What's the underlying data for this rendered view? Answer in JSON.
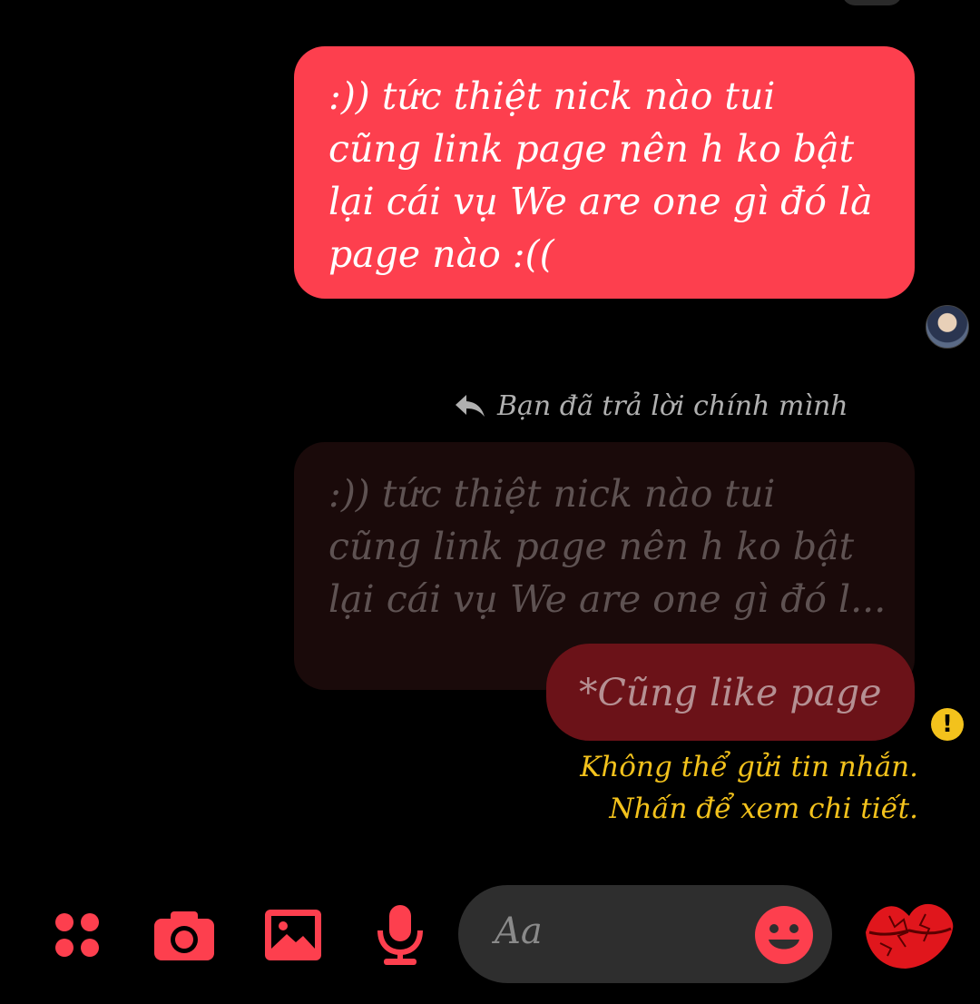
{
  "colors": {
    "accent": "#fd3f4e",
    "warning": "#f3c21c",
    "background": "#000000"
  },
  "messages": {
    "sent": {
      "lines": [
        ":)) tức thiệt nick nào tui",
        "cũng link page nên h ko bật",
        "lại cái vụ We are one gì đó là",
        "page nào :(("
      ]
    },
    "reply_header": "Bạn đã trả lời chính mình",
    "quoted": {
      "lines": [
        ":)) tức thiệt nick nào tui",
        "cũng link page nên h ko bật",
        "lại cái vụ We are one gì đó l..."
      ]
    },
    "failed": {
      "text": "*Cũng like page",
      "error_lines": [
        "Không thể gửi tin nhắn.",
        "Nhấn để xem chi tiết."
      ]
    }
  },
  "composer": {
    "placeholder": "Aa",
    "icons": [
      "apps-icon",
      "camera-icon",
      "gallery-icon",
      "microphone-icon",
      "emoji-icon",
      "kiss-lips-icon"
    ]
  }
}
